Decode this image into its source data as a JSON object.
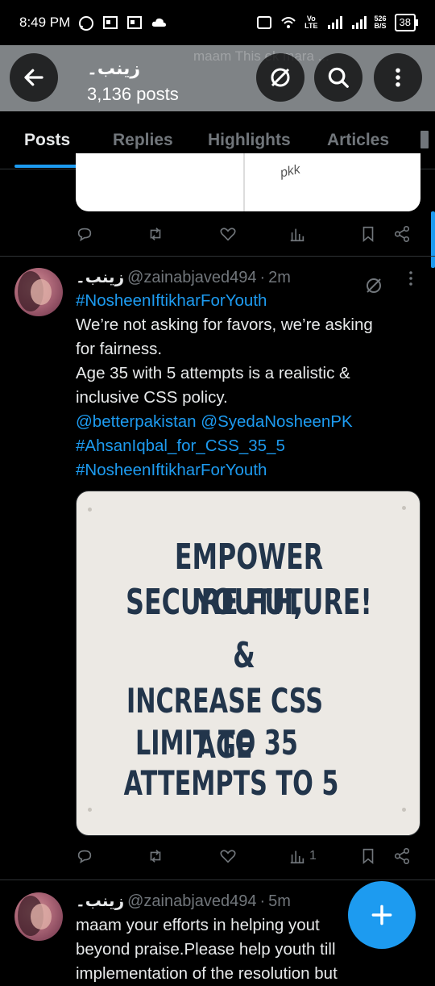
{
  "status_bar": {
    "time": "8:49 PM",
    "network_speed_value": "526",
    "network_speed_unit": "B/S",
    "battery": "38",
    "volte_top": "Vo",
    "volte_bottom": "LTE"
  },
  "header": {
    "name": "زینب۔",
    "post_count": "3,136 posts",
    "background_text": "maam This ek mara ..."
  },
  "tabs": [
    {
      "label": "Posts",
      "active": true
    },
    {
      "label": "Replies",
      "active": false
    },
    {
      "label": "Highlights",
      "active": false
    },
    {
      "label": "Articles",
      "active": false
    }
  ],
  "previous_post": {
    "image_scribble": "pkk"
  },
  "post": {
    "display_name": "زینب۔",
    "handle": "@zainabjaved494",
    "separator": "·",
    "time": "2m",
    "body": [
      {
        "text": "#NosheenIftikharForYouth",
        "link": true
      },
      {
        "text": "We’re not asking for favors, we’re asking",
        "link": false
      },
      {
        "text": "for fairness.",
        "link": false
      },
      {
        "text": "Age 35 with 5 attempts is a realistic &",
        "link": false
      },
      {
        "text": "inclusive CSS policy.",
        "link": false
      },
      {
        "text": "@betterpakistan @SyedaNosheenPK",
        "link": true
      },
      {
        "text": "#AhsanIqbal_for_CSS_35_5",
        "link": true
      },
      {
        "text": "#NosheenIftikharForYouth",
        "link": true
      }
    ],
    "image_text": [
      "EMPOWER YOUTH,",
      "SECURE FUTURE!",
      "&",
      "INCREASE CSS AGE",
      "LIMIT TO 35",
      "ATTEMPTS TO 5"
    ],
    "views_count": "1"
  },
  "next_post": {
    "display_name": "زینب۔",
    "handle": "@zainabjaved494",
    "separator": "·",
    "time": "5m",
    "body": [
      "maam your efforts in helping yout",
      "beyond praise.Please help youth till",
      "implementation of the resolution but"
    ]
  },
  "colors": {
    "accent": "#1d9bf0",
    "background": "#000000",
    "muted": "#71767b",
    "banner_text": "#22354b"
  }
}
